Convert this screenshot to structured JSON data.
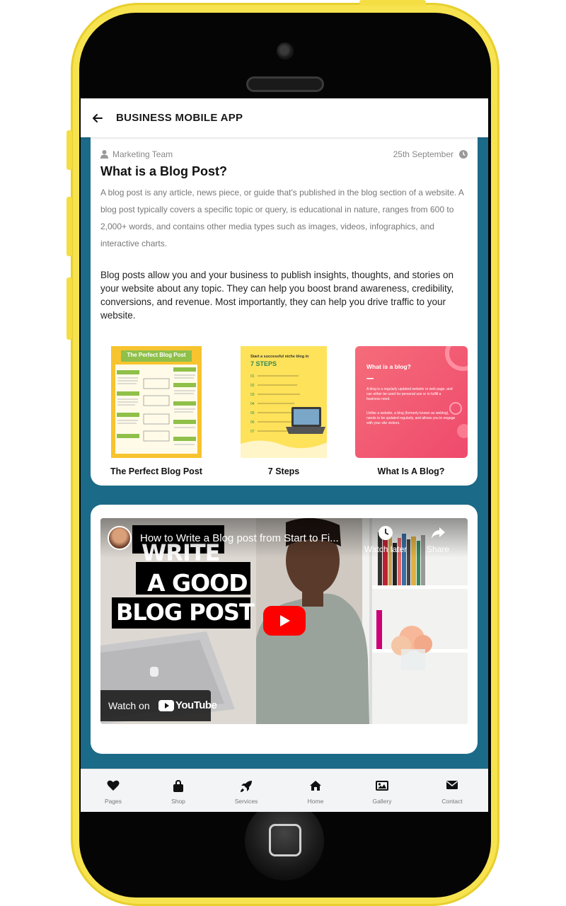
{
  "app": {
    "title": "BUSINESS MOBILE APP"
  },
  "post": {
    "author": "Marketing Team",
    "date": "25th September",
    "title": "What is a Blog Post?",
    "paragraph1": "A blog post is any article, news piece, or guide that's published in the blog section of a website. A blog post typically covers a specific topic or query, is educational in nature, ranges from 600 to 2,000+ words, and contains other media types such as images, videos, infographics, and interactive charts.",
    "paragraph2": "Blog posts allow you and your business to publish insights, thoughts, and stories on your website about any topic. They can help you boost brand awareness, credibility, conversions, and revenue. Most importantly, they can help you drive traffic to your website."
  },
  "gallery": [
    {
      "caption": "The Perfect Blog Post",
      "image_title": "The Perfect Blog Post"
    },
    {
      "caption": "7 Steps",
      "image_small": "Start a successful niche blog in",
      "image_title": "7 STEPS"
    },
    {
      "caption": "What Is A Blog?",
      "image_title": "What is a blog?",
      "image_text1": "A blog is a regularly updated website or web page, and can either be used for personal use or to fulfill a business need.",
      "image_text2": "Unlike a website, a blog (formerly known as weblog), needs to be updated regularly, and allows you to engage with your site visitors."
    }
  ],
  "video": {
    "title": "How to Write a Blog post from Start to Fi...",
    "watch_later": "Watch later",
    "share": "Share",
    "overlay_line1": "WRITE",
    "overlay_line2": "A GOOD",
    "overlay_line3": "BLOG POST",
    "watch_on": "Watch on",
    "youtube": "YouTube"
  },
  "nav": [
    {
      "label": "Pages",
      "icon": "heart-icon"
    },
    {
      "label": "Shop",
      "icon": "shopping-bag-icon"
    },
    {
      "label": "Services",
      "icon": "rocket-icon"
    },
    {
      "label": "Home",
      "icon": "home-icon"
    },
    {
      "label": "Gallery",
      "icon": "image-icon"
    },
    {
      "label": "Contact",
      "icon": "envelope-icon"
    }
  ],
  "colors": {
    "frame": "#f7e34f",
    "screen_bg": "#1b6a87",
    "youtube_red": "#ff0000",
    "pink_card": "#f0516f"
  }
}
